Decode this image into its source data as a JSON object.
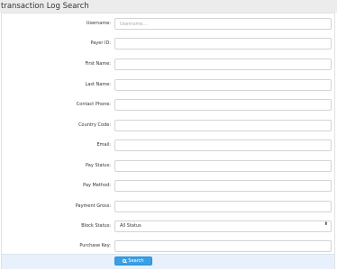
{
  "page": {
    "title": "transaction Log Search"
  },
  "form": {
    "fields": [
      {
        "label": "Username:",
        "value": "",
        "placeholder": "Username..."
      },
      {
        "label": "Payer ID:",
        "value": "",
        "placeholder": ""
      },
      {
        "label": "First Name:",
        "value": "",
        "placeholder": ""
      },
      {
        "label": "Last Name:",
        "value": "",
        "placeholder": ""
      },
      {
        "label": "Contact Phone:",
        "value": "",
        "placeholder": ""
      },
      {
        "label": "Country Code:",
        "value": "",
        "placeholder": ""
      },
      {
        "label": "Email:",
        "value": "",
        "placeholder": ""
      },
      {
        "label": "Pay Status:",
        "value": "",
        "placeholder": ""
      },
      {
        "label": "Pay Method:",
        "value": "",
        "placeholder": ""
      },
      {
        "label": "Payment Gross:",
        "value": "",
        "placeholder": ""
      },
      {
        "label": "Block Status:",
        "selected": "All Status"
      },
      {
        "label": "Purchase Key:",
        "value": "",
        "placeholder": ""
      }
    ],
    "search_label": "Search"
  },
  "icons": {
    "search": "search-icon",
    "select_arrow": "select-arrows-icon"
  },
  "colors": {
    "button": "#3a9fe6",
    "footer": "#e8f1fb",
    "titlebar": "#ececec"
  }
}
